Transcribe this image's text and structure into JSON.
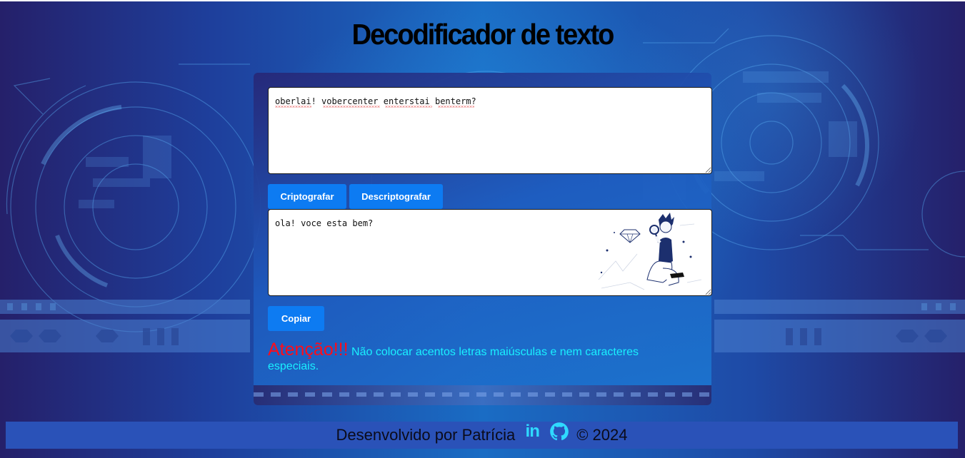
{
  "header": {
    "title": "Decodificador de texto"
  },
  "input": {
    "value": "oberlai! vobercenter enterstai benterm?"
  },
  "buttons": {
    "encrypt_label": "Criptografar",
    "decrypt_label": "Descriptografar",
    "copy_label": "Copiar"
  },
  "output": {
    "value": "ola! voce esta bem?",
    "illustration_icon": "person-with-magnifier-diamond-illustration"
  },
  "warning": {
    "label": "Atenção!!!",
    "text": "Não colocar acentos letras maiúsculas e nem caracteres especiais."
  },
  "footer": {
    "credit": "Desenvolvido por Patrícia",
    "linkedin_icon_text": "in",
    "linkedin_icon": "linkedin-icon",
    "github_icon": "github-icon",
    "copyright": "© 2024"
  },
  "colors": {
    "accent_button": "#0d7bf2",
    "warning_label": "#ff0d1a",
    "warning_text": "#19f0ff",
    "footer_bar": "#2a52b8",
    "icon": "#2fd9ff"
  }
}
